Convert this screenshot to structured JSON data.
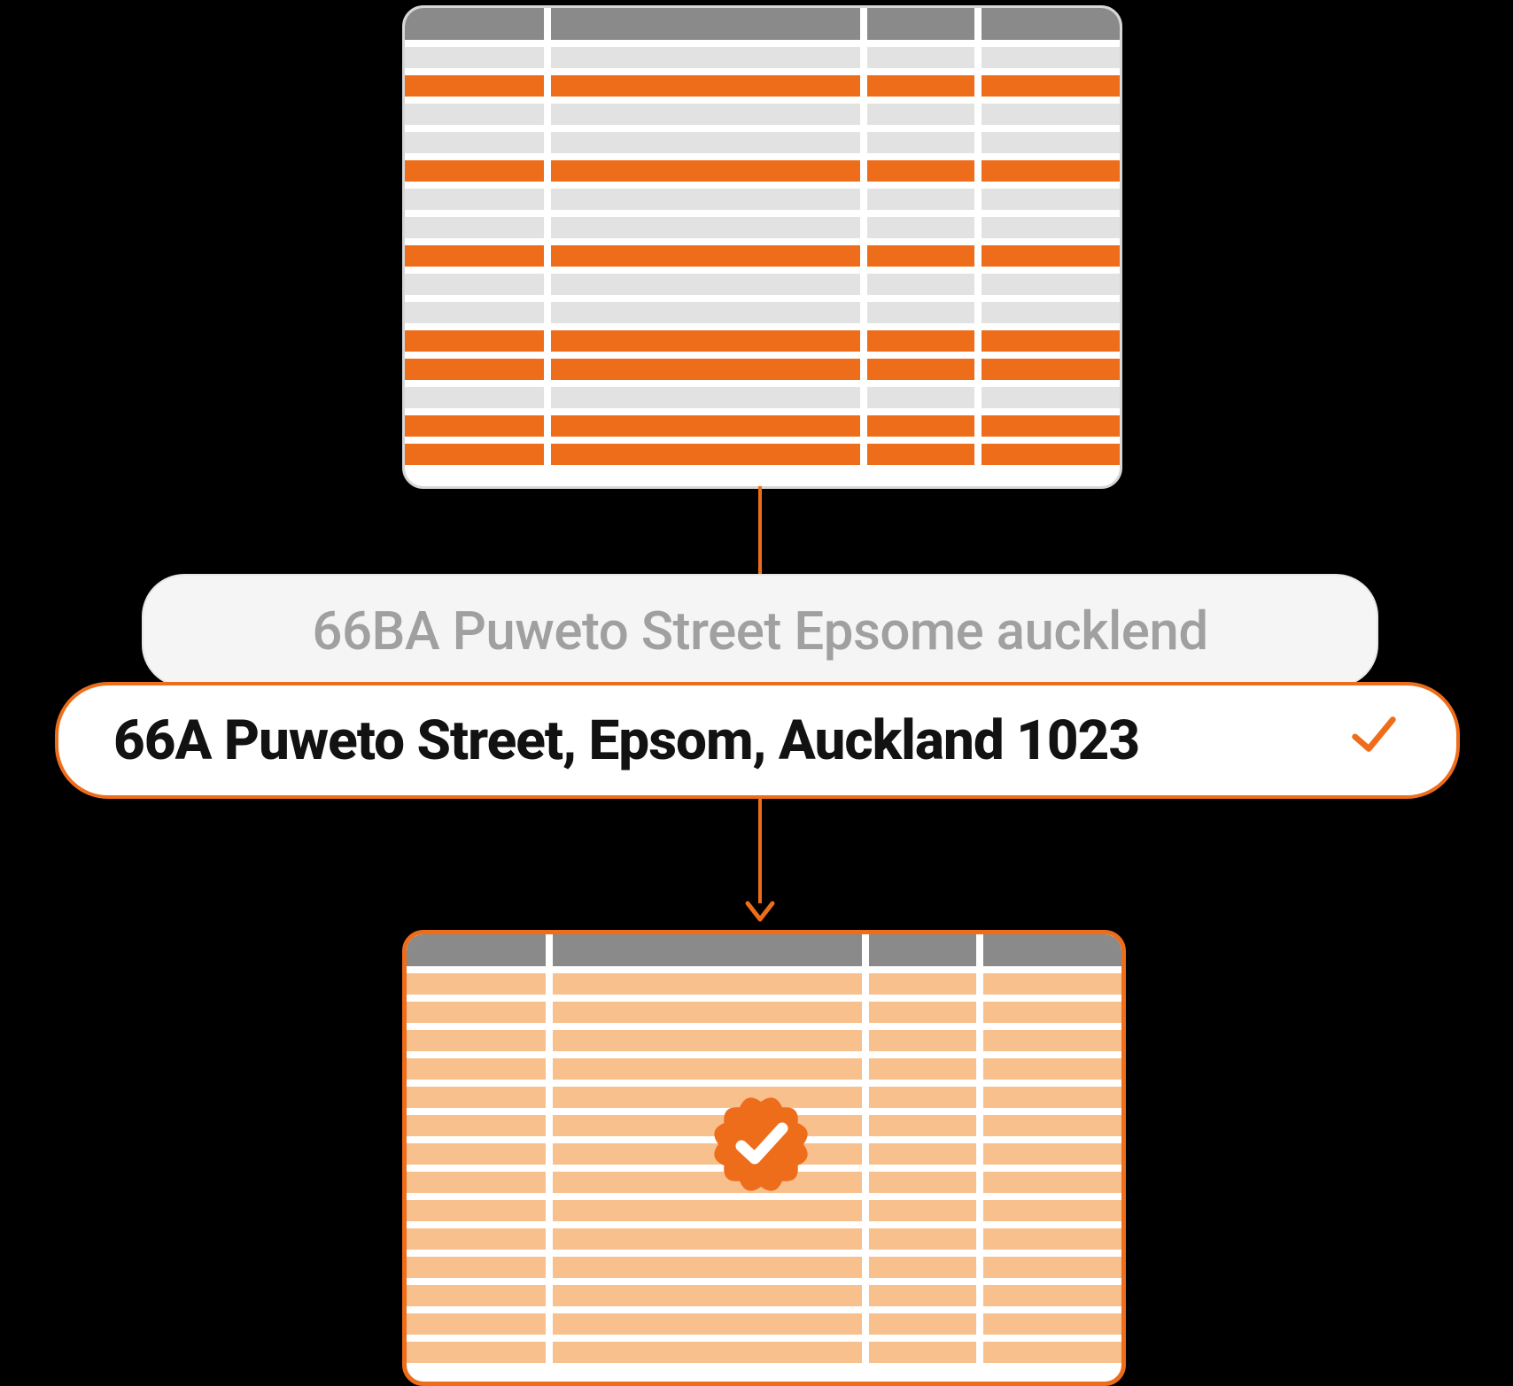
{
  "colors": {
    "accent": "#ee6d1a",
    "accent_light": "#f8c08d",
    "grey_header": "#8a8a8a",
    "grey_row": "#e2e2e2",
    "grey_text": "#a0a0a0",
    "pill_bg": "#f5f5f5"
  },
  "top_sheet": {
    "description": "input spreadsheet with raw / messy address data",
    "rows": [
      {
        "highlighted": false
      },
      {
        "highlighted": true
      },
      {
        "highlighted": false
      },
      {
        "highlighted": false
      },
      {
        "highlighted": true
      },
      {
        "highlighted": false
      },
      {
        "highlighted": false
      },
      {
        "highlighted": true
      },
      {
        "highlighted": false
      },
      {
        "highlighted": false
      },
      {
        "highlighted": true
      },
      {
        "highlighted": true
      },
      {
        "highlighted": false
      },
      {
        "highlighted": true
      },
      {
        "highlighted": true
      }
    ]
  },
  "raw_address": "66BA Puweto Street Epsome aucklend",
  "clean_address": "66A Puweto Street, Epsom, Auckland 1023",
  "bottom_sheet": {
    "description": "output spreadsheet with validated addresses",
    "row_count": 14
  },
  "icons": {
    "check": "checkmark",
    "verified_badge": "verified seal with checkmark"
  }
}
